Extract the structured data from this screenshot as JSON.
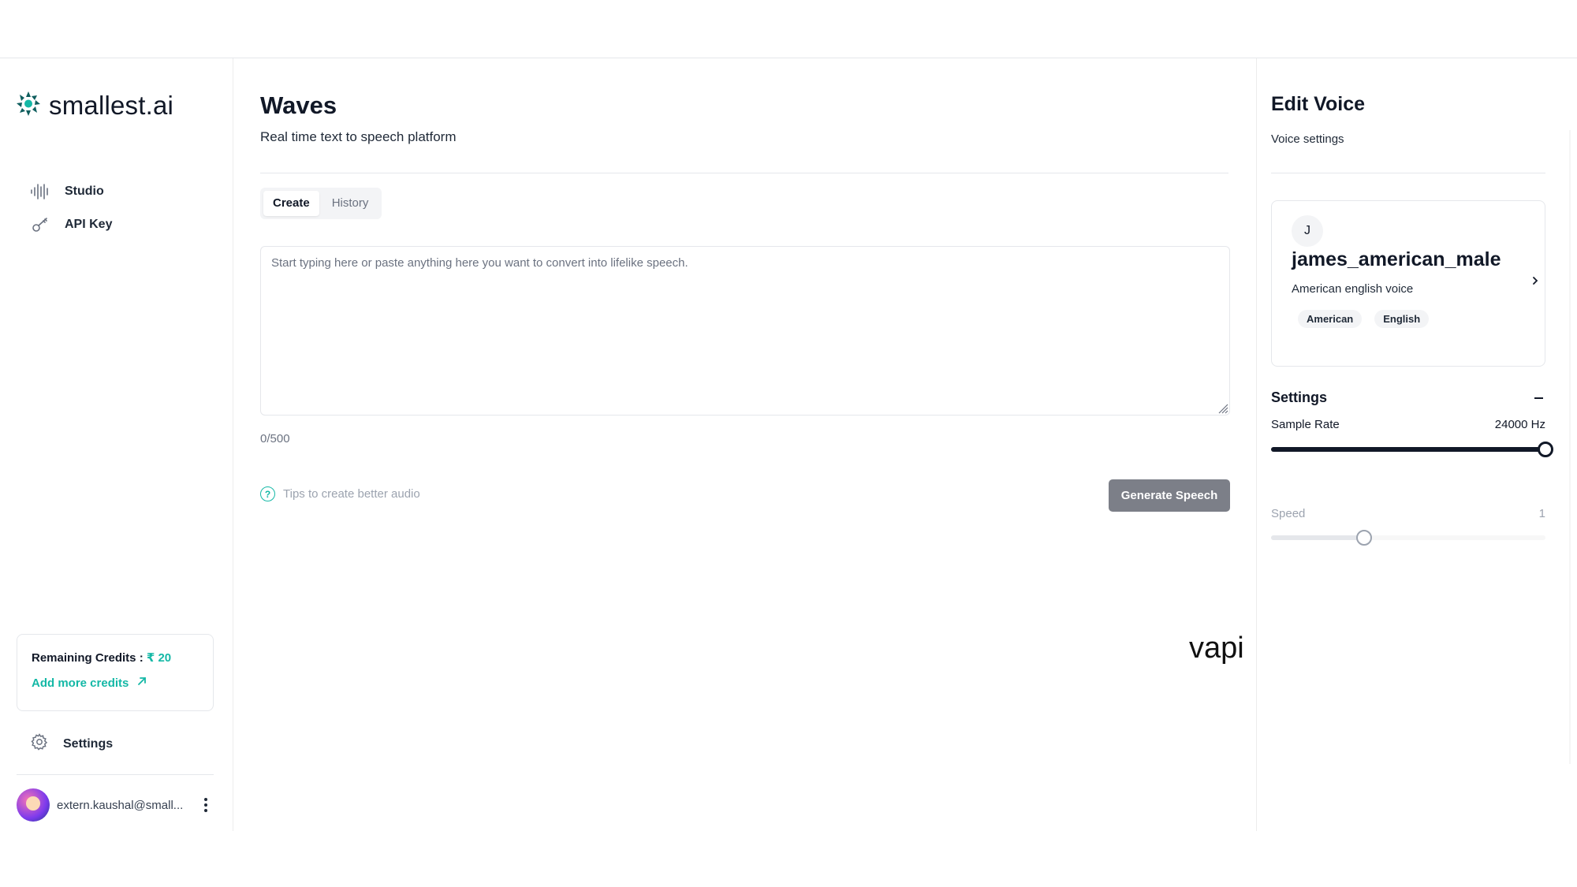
{
  "brand": {
    "name": "smallest.ai",
    "icon": "smallest-logo-icon"
  },
  "sidebar": {
    "items": [
      {
        "label": "Studio",
        "icon": "waveform-icon"
      },
      {
        "label": "API Key",
        "icon": "key-icon"
      }
    ],
    "credits": {
      "label": "Remaining Credits :",
      "amount": "₹ 20",
      "add_link": "Add more credits"
    },
    "settings_label": "Settings",
    "user": {
      "email": "extern.kaushal@small..."
    }
  },
  "main": {
    "title": "Waves",
    "subtitle": "Real time text to speech platform",
    "tabs": [
      {
        "label": "Create",
        "active": true
      },
      {
        "label": "History",
        "active": false
      }
    ],
    "textarea_placeholder": "Start typing here or paste anything here you want to convert into lifelike speech.",
    "textarea_value": "",
    "char_count": "0/500",
    "tips_label": "Tips to create better audio",
    "tips_icon": "question-circle-icon",
    "generate_label": "Generate Speech",
    "watermark": "vapi"
  },
  "edit_voice": {
    "title": "Edit Voice",
    "subtitle": "Voice settings",
    "voice": {
      "initial": "J",
      "name": "james_american_male",
      "description": "American english voice",
      "tags": [
        "American",
        "English"
      ]
    },
    "settings": {
      "title": "Settings",
      "sample_rate": {
        "label": "Sample Rate",
        "value": "24000 Hz",
        "level": 1.0
      },
      "speed": {
        "label": "Speed",
        "value": "1",
        "level": 0.34
      }
    }
  },
  "colors": {
    "accent": "#14b8a6",
    "slider_active": "#111827",
    "slider_disabled": "#e5e7eb",
    "button_disabled": "#7c7f88"
  }
}
